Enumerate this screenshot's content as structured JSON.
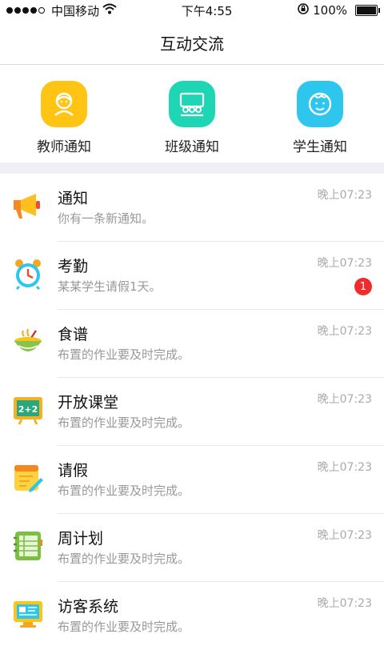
{
  "status_bar": {
    "carrier": "中国移动",
    "time": "下午4:55",
    "battery": "100%",
    "icons": [
      "signal-dots",
      "wifi-icon",
      "rotation-lock-icon",
      "battery-icon"
    ]
  },
  "header": {
    "title": "互动交流"
  },
  "quick_actions": [
    {
      "label": "教师通知",
      "icon": "teacher-icon",
      "color": "#ffc414"
    },
    {
      "label": "班级通知",
      "icon": "class-icon",
      "color": "#1ed6b3"
    },
    {
      "label": "学生通知",
      "icon": "student-icon",
      "color": "#2fc6ee"
    }
  ],
  "list": [
    {
      "title": "通知",
      "subtitle": "你有一条新通知。",
      "time": "晚上07:23",
      "icon": "megaphone-icon",
      "badge": ""
    },
    {
      "title": "考勤",
      "subtitle": "某某学生请假1天。",
      "time": "晚上07:23",
      "icon": "alarm-clock-icon",
      "badge": "1"
    },
    {
      "title": "食谱",
      "subtitle": "布置的作业要及时完成。",
      "time": "晚上07:23",
      "icon": "food-bowl-icon",
      "badge": ""
    },
    {
      "title": "开放课堂",
      "subtitle": "布置的作业要及时完成。",
      "time": "晚上07:23",
      "icon": "blackboard-icon",
      "badge": ""
    },
    {
      "title": "请假",
      "subtitle": "布置的作业要及时完成。",
      "time": "晚上07:23",
      "icon": "notepad-icon",
      "badge": ""
    },
    {
      "title": "周计划",
      "subtitle": "布置的作业要及时完成。",
      "time": "晚上07:23",
      "icon": "planner-icon",
      "badge": ""
    },
    {
      "title": "访客系统",
      "subtitle": "布置的作业要及时完成。",
      "time": "晚上07:23",
      "icon": "monitor-icon",
      "badge": ""
    }
  ],
  "badge_icon_text": {
    "blackboard": "2+2"
  }
}
